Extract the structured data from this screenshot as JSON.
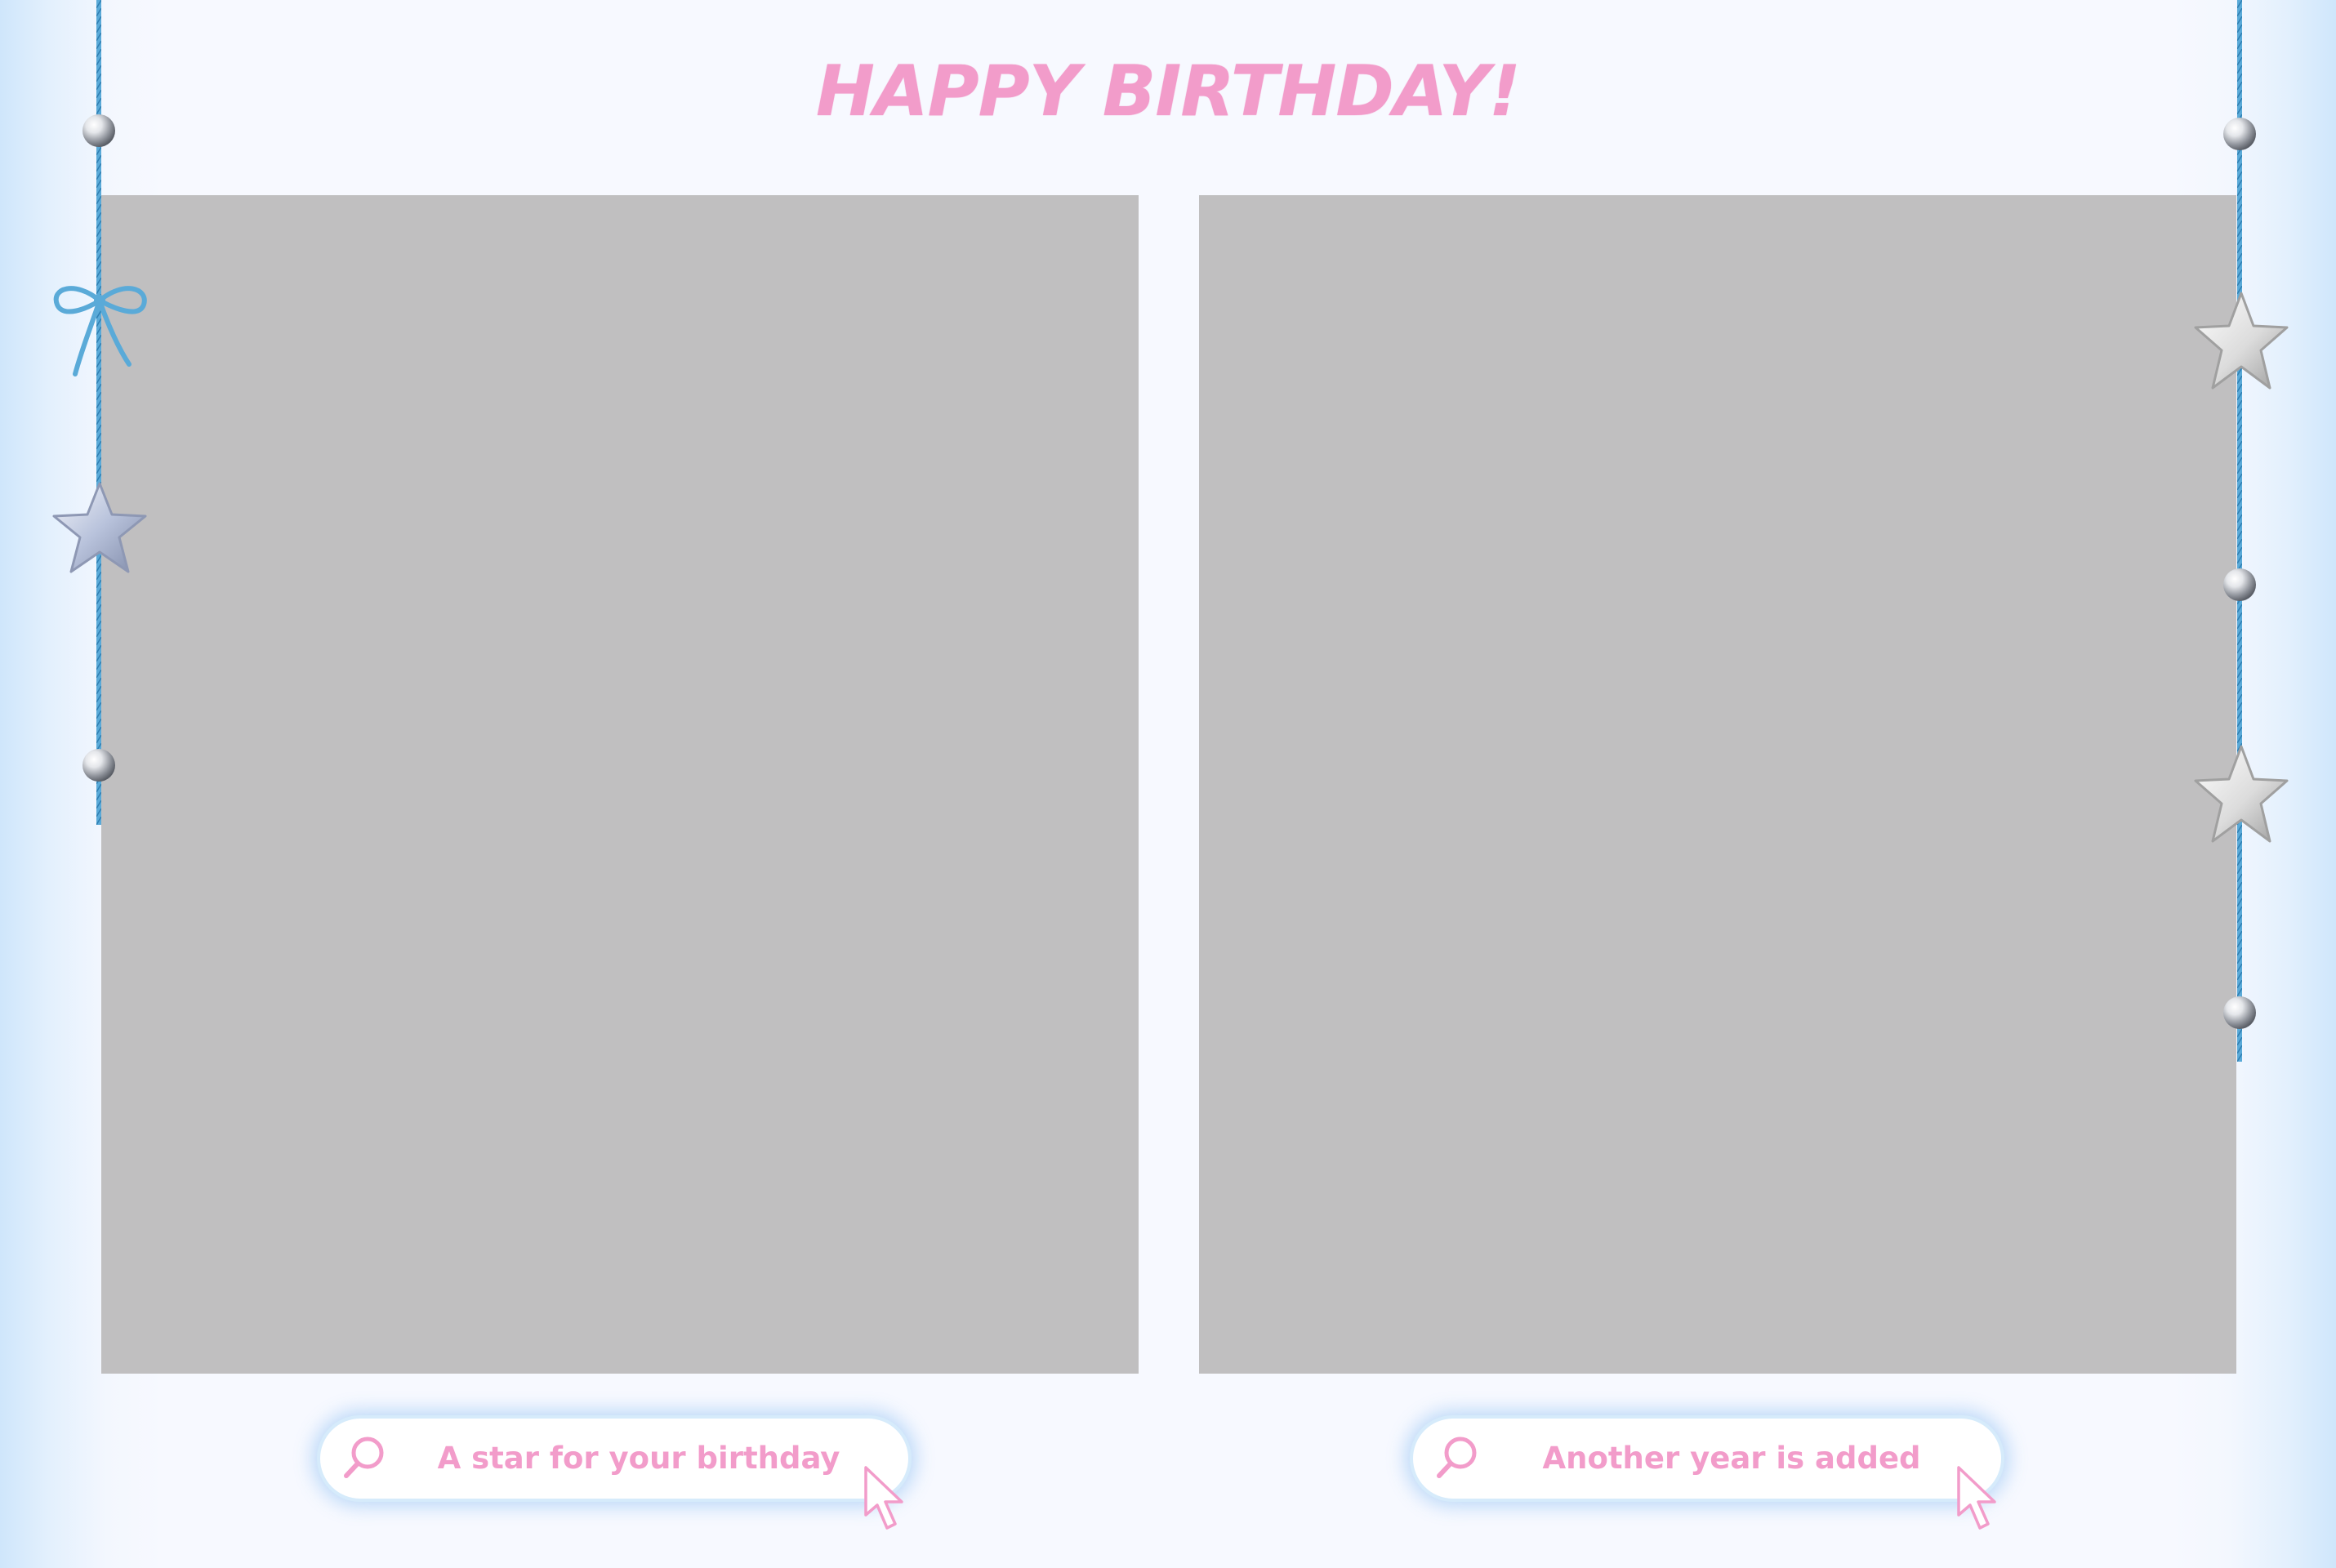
{
  "title": "HAPPY BIRTHDAY!",
  "photos": [
    {
      "name": "photo-placeholder-left"
    },
    {
      "name": "photo-placeholder-right"
    }
  ],
  "search_bars": [
    {
      "text": "A star for your birthday",
      "icon": "search-icon",
      "pointer": "cursor-arrow-icon"
    },
    {
      "text": "Another year is added",
      "icon": "search-icon",
      "pointer": "cursor-arrow-icon"
    }
  ],
  "colors": {
    "title": "#f29cca",
    "photo_placeholder": "#c0bfc0",
    "string": "#5aaad8",
    "background": "#f7f9ff",
    "glow": "#9ccdf4"
  },
  "decorations": {
    "left": [
      "bead",
      "bow-icon",
      "star-icon",
      "bead"
    ],
    "right": [
      "bead",
      "star-icon",
      "bead",
      "star-icon",
      "bead"
    ]
  }
}
